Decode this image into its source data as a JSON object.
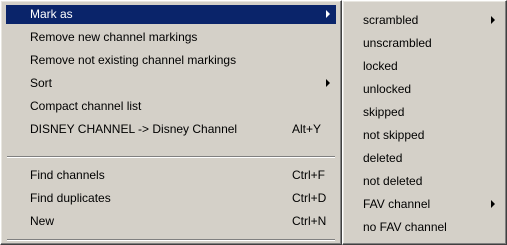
{
  "main_menu": {
    "items": [
      {
        "label": "Mark as",
        "has_submenu": true,
        "selected": true
      },
      {
        "label": "Remove new channel markings"
      },
      {
        "label": "Remove not existing channel markings"
      },
      {
        "label": "Sort",
        "has_submenu": true
      },
      {
        "label": "Compact channel list"
      },
      {
        "label": "DISNEY CHANNEL -> Disney Channel",
        "shortcut": "Alt+Y"
      },
      {
        "label": "Find channels",
        "shortcut": "Ctrl+F"
      },
      {
        "label": "Find duplicates",
        "shortcut": "Ctrl+D"
      },
      {
        "label": "New",
        "shortcut": "Ctrl+N"
      }
    ]
  },
  "sub_menu": {
    "items": [
      {
        "label": "scrambled",
        "has_submenu": true
      },
      {
        "label": "unscrambled"
      },
      {
        "label": "locked"
      },
      {
        "label": "unlocked"
      },
      {
        "label": "skipped"
      },
      {
        "label": "not skipped"
      },
      {
        "label": "deleted"
      },
      {
        "label": "not deleted"
      },
      {
        "label": "FAV channel",
        "has_submenu": true
      },
      {
        "label": "no FAV channel"
      }
    ]
  },
  "colors": {
    "menu_background": "#d4d0c8",
    "selection_background": "#0a246a",
    "selection_text": "#ffffff"
  }
}
